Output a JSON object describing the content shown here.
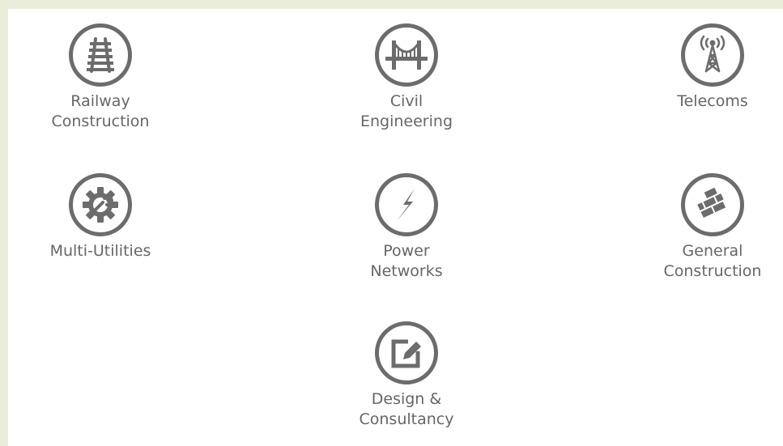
{
  "services": [
    {
      "id": "railway",
      "label": "Railway\nConstruction",
      "icon": "railway-icon"
    },
    {
      "id": "civil",
      "label": "Civil\nEngineering",
      "icon": "bridge-icon"
    },
    {
      "id": "telecoms",
      "label": "Telecoms",
      "icon": "telecom-tower-icon"
    },
    {
      "id": "utilities",
      "label": "Multi-Utilities",
      "icon": "gear-wrench-icon"
    },
    {
      "id": "power",
      "label": "Power\nNetworks",
      "icon": "lightning-icon"
    },
    {
      "id": "general",
      "label": "General\nConstruction",
      "icon": "bricks-icon"
    },
    {
      "id": "design",
      "label": "Design &\nConsultancy",
      "icon": "edit-icon"
    }
  ],
  "colors": {
    "icon": "#6c6c6c",
    "text": "#666666",
    "background": "#e9edd9",
    "panel": "#ffffff"
  }
}
